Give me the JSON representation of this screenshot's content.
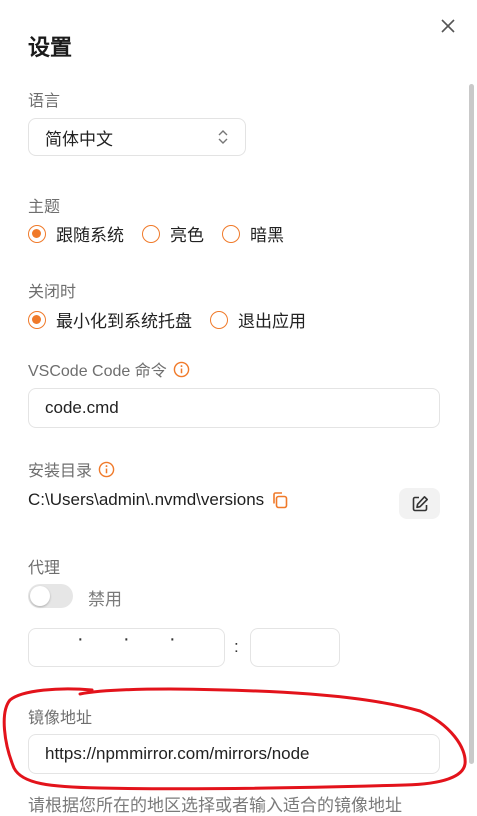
{
  "dialog": {
    "title": "设置"
  },
  "language": {
    "label": "语言",
    "value": "简体中文"
  },
  "theme": {
    "label": "主题",
    "options": [
      {
        "label": "跟随系统",
        "selected": true
      },
      {
        "label": "亮色",
        "selected": false
      },
      {
        "label": "暗黑",
        "selected": false
      }
    ]
  },
  "on_close": {
    "label": "关闭时",
    "options": [
      {
        "label": "最小化到系统托盘",
        "selected": true
      },
      {
        "label": "退出应用",
        "selected": false
      }
    ]
  },
  "vscode": {
    "label": "VSCode Code 命令",
    "value": "code.cmd"
  },
  "install_dir": {
    "label": "安装目录",
    "path": "C:\\Users\\admin\\.nvmd\\versions"
  },
  "proxy": {
    "label": "代理",
    "toggle_label": "禁用",
    "enabled": false,
    "ip_dots": [
      "·",
      "·",
      "·"
    ],
    "colon": ":"
  },
  "mirror": {
    "label": "镜像地址",
    "value": "https://npmmirror.com/mirrors/node",
    "hint": "请根据您所在的地区选择或者输入适合的镜像地址"
  },
  "colors": {
    "accent": "#f07a2a",
    "annotation": "#e3131b"
  }
}
